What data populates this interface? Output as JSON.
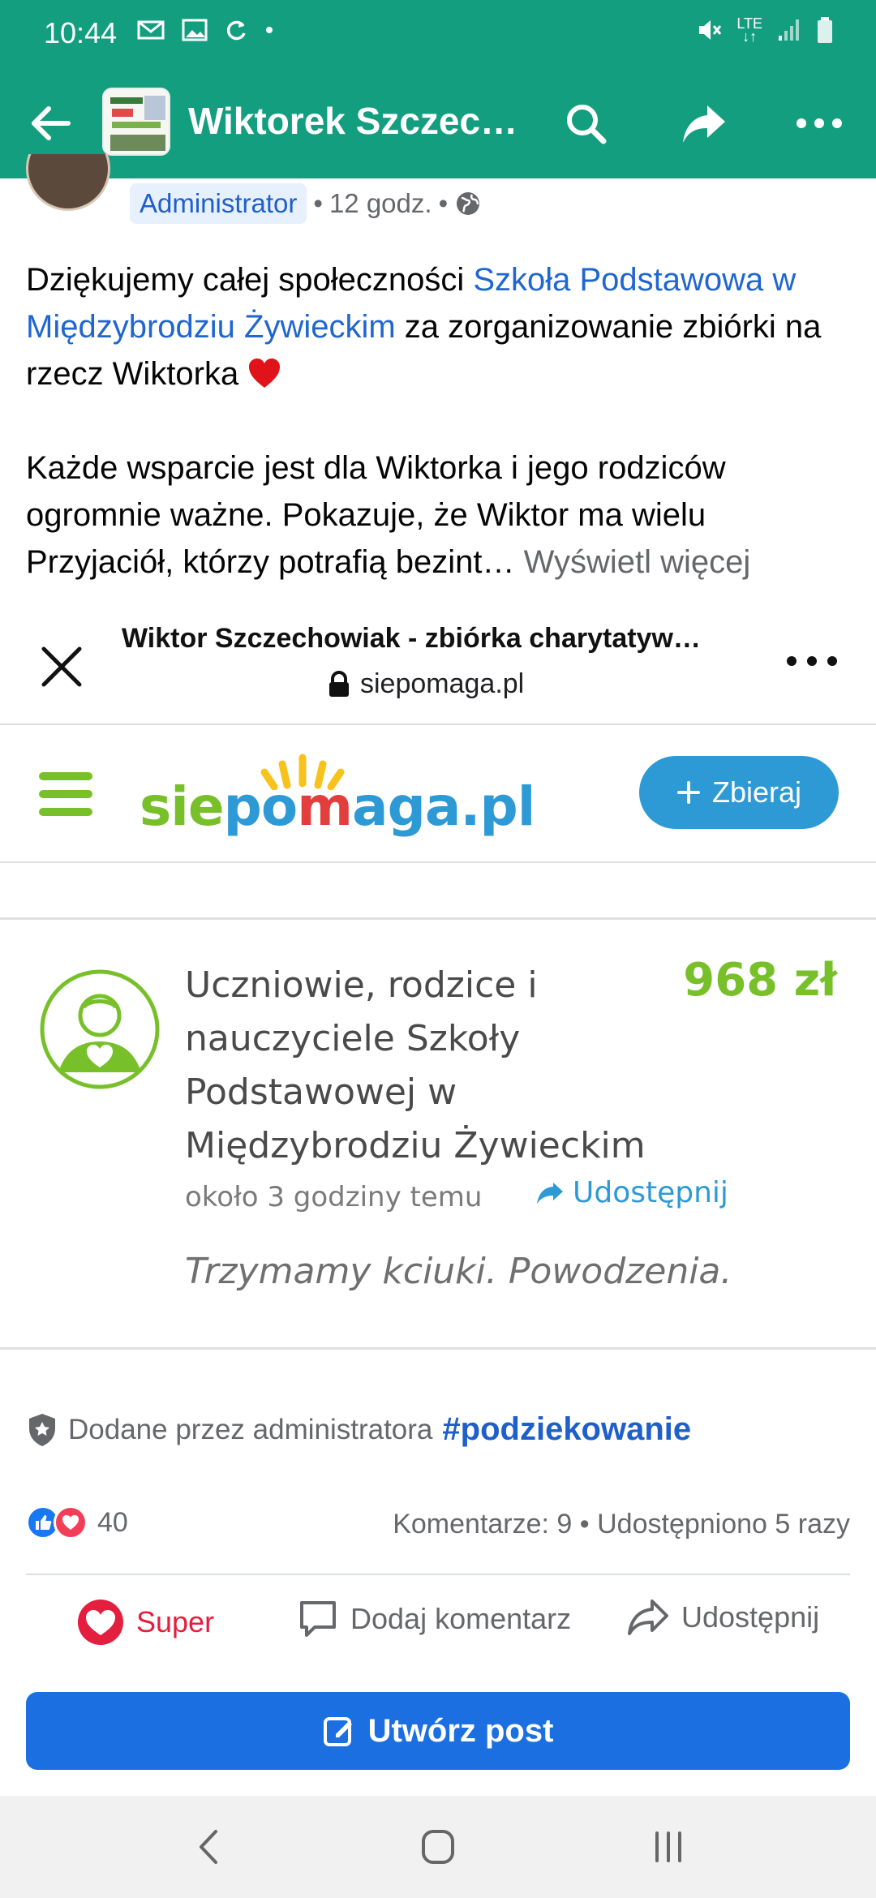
{
  "status_bar": {
    "time": "10:44",
    "network": "LTE"
  },
  "app_bar": {
    "title": "Wiktorek Szczec…"
  },
  "post": {
    "role_badge": "Administrator",
    "time": "12 godz.",
    "text_1": "Dziękujemy całej społeczności ",
    "text_link": "Szkoła Podstawowa w Międzybrodziu Żywieckim",
    "text_2": " za zorganizowanie zbiórki na rzecz Wiktorka ",
    "text_3": "Każde wsparcie jest dla Wiktorka i jego rodziców ogromnie ważne. Pokazuje, że Wiktor ma wielu Przyjaciół, którzy potrafią bezint…",
    "see_more": "Wyświetl więcej"
  },
  "preview": {
    "title": "Wiktor Szczechowiak - zbiórka charytatyw…",
    "url": "siepomaga.pl"
  },
  "siepomaga": {
    "logo_a": "sie",
    "logo_b": "po",
    "logo_c": "m",
    "logo_d": "aga",
    "logo_e": ".pl",
    "cta": "Zbieraj",
    "donor_name": "Uczniowie, rodzice i nauczyciele Szkoły Podstawowej w Międzybrodziu Żywieckim",
    "amount": "968 zł",
    "time_ago": "około 3 godziny temu",
    "share": "Udostępnij",
    "message": "Trzymamy kciuki. Powodzenia."
  },
  "footer": {
    "added_by": "Dodane przez administratora",
    "hashtag": "#podziekowanie",
    "reactions_count": "40",
    "comments_shares": "Komentarze: 9 • Udostępniono 5 razy",
    "action_super": "Super",
    "action_comment": "Dodaj komentarz",
    "action_share": "Udostępnij",
    "create_post": "Utwórz post"
  },
  "colors": {
    "header": "#149e80",
    "link": "#1f66d1",
    "siepomaga_green": "#78c02a",
    "siepomaga_blue": "#2d9ad6",
    "primary_button": "#1b6fe0"
  }
}
